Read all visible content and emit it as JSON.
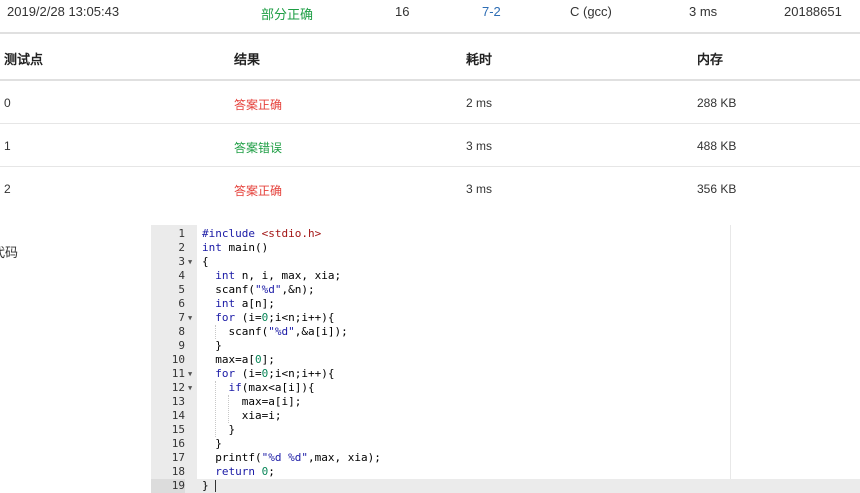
{
  "submission": {
    "time": "2019/2/28 13:05:43",
    "status": "部分正确",
    "score": "16",
    "problem": "7-2",
    "compiler": "C (gcc)",
    "runtime": "3 ms",
    "user": "20188651"
  },
  "table": {
    "headers": [
      "测试点",
      "结果",
      "耗时",
      "内存"
    ],
    "rows": [
      {
        "id": "0",
        "result": "答案正确",
        "time": "2 ms",
        "memory": "288 KB"
      },
      {
        "id": "1",
        "result": "答案错误",
        "time": "3 ms",
        "memory": "488 KB"
      },
      {
        "id": "2",
        "result": "答案正确",
        "time": "3 ms",
        "memory": "356 KB"
      }
    ]
  },
  "code_section_label": "代码",
  "code": {
    "lines": [
      "#include <stdio.h>",
      "int main()",
      "{",
      "  int n, i, max, xia;",
      "  scanf(\"%d\",&n);",
      "  int a[n];",
      "  for (i=0;i<n;i++){",
      "    scanf(\"%d\",&a[i]);",
      "  }",
      "  max=a[0];",
      "  for (i=0;i<n;i++){",
      "    if(max<a[i]){",
      "      max=a[i];",
      "      xia=i;",
      "    }",
      "  }",
      "  printf(\"%d %d\",max, xia);",
      "  return 0;",
      "}"
    ],
    "line_numbers": [
      "1",
      "2",
      "3",
      "4",
      "5",
      "6",
      "7",
      "8",
      "9",
      "10",
      "11",
      "12",
      "13",
      "14",
      "15",
      "16",
      "17",
      "18",
      "19"
    ],
    "fold_lines": [
      3,
      7,
      11,
      12
    ],
    "active_line": 19
  },
  "colors": {
    "status_green": "#1e9e44",
    "result_red": "#e5403a",
    "link_blue": "#2d6db4"
  }
}
